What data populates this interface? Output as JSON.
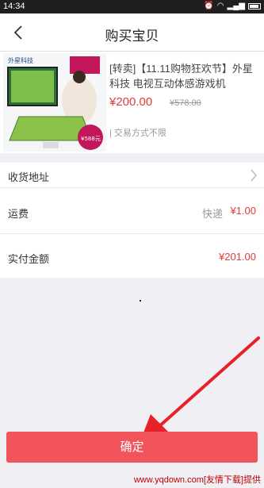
{
  "status_bar": {
    "time": "14:34"
  },
  "header": {
    "title": "购买宝贝"
  },
  "product": {
    "name": "[转卖]【11.11购物狂欢节】外星科技 电视互动体感游戏机",
    "price": "¥200.00",
    "original_price": "¥578.00",
    "trade_note": "| 交易方式不限",
    "image_brand_text": "外星科技",
    "image_badge_price": "¥588元"
  },
  "address": {
    "label": "收货地址"
  },
  "shipping": {
    "label": "运费",
    "method": "快递",
    "value": "¥1.00"
  },
  "total": {
    "label": "实付金额",
    "value": "¥201.00"
  },
  "confirm": {
    "label": "确定"
  },
  "watermark": {
    "text": "www.yqdown.com[友情下载]提供"
  },
  "colors": {
    "accent_red": "#e13b3b",
    "button_red": "#f2545b",
    "arrow_red": "#e8202a"
  }
}
